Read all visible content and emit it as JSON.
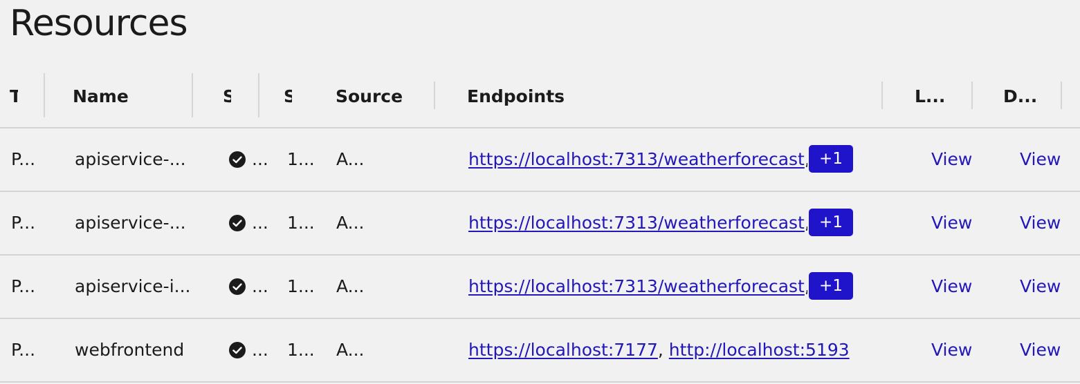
{
  "page": {
    "title": "Resources"
  },
  "colors": {
    "link": "#2217b9",
    "badge_bg": "#1f14c9",
    "badge_text": "#ffffff",
    "background": "#f1f1f1",
    "divider": "#d3d3d3"
  },
  "table": {
    "headers": {
      "type": "T",
      "name": "Name",
      "state": "S",
      "start": "S",
      "source": "Source",
      "endpoints": "Endpoints",
      "logs": "L...",
      "details": "D..."
    },
    "rows": [
      {
        "type": "P...",
        "name": "apiservice-...",
        "state_icon": "check-circle-icon",
        "state": "...",
        "start": "1...",
        "source": "A...",
        "endpoint_1": "https://localhost:7313/weatherforecast",
        "endpoint_separator": ",",
        "endpoint_more": "+1",
        "logs": "View",
        "details": "View"
      },
      {
        "type": "P...",
        "name": "apiservice-...",
        "state_icon": "check-circle-icon",
        "state": "...",
        "start": "1...",
        "source": "A...",
        "endpoint_1": "https://localhost:7313/weatherforecast",
        "endpoint_separator": ",",
        "endpoint_more": "+1",
        "logs": "View",
        "details": "View"
      },
      {
        "type": "P...",
        "name": "apiservice-i...",
        "state_icon": "check-circle-icon",
        "state": "...",
        "start": "1...",
        "source": "A...",
        "endpoint_1": "https://localhost:7313/weatherforecast",
        "endpoint_separator": ",",
        "endpoint_more": "+1",
        "logs": "View",
        "details": "View"
      },
      {
        "type": "P...",
        "name": "webfrontend",
        "state_icon": "check-circle-icon",
        "state": "...",
        "start": "1...",
        "source": "A...",
        "endpoint_1": "https://localhost:7177",
        "endpoint_separator": ",",
        "endpoint_2": "http://localhost:5193",
        "logs": "View",
        "details": "View"
      }
    ]
  }
}
